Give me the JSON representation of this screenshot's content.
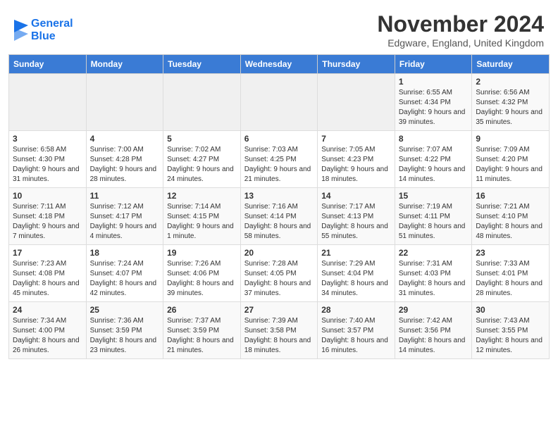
{
  "header": {
    "logo_line1": "General",
    "logo_line2": "Blue",
    "month_title": "November 2024",
    "subtitle": "Edgware, England, United Kingdom"
  },
  "calendar": {
    "days_of_week": [
      "Sunday",
      "Monday",
      "Tuesday",
      "Wednesday",
      "Thursday",
      "Friday",
      "Saturday"
    ],
    "weeks": [
      [
        {
          "day": "",
          "info": ""
        },
        {
          "day": "",
          "info": ""
        },
        {
          "day": "",
          "info": ""
        },
        {
          "day": "",
          "info": ""
        },
        {
          "day": "",
          "info": ""
        },
        {
          "day": "1",
          "info": "Sunrise: 6:55 AM\nSunset: 4:34 PM\nDaylight: 9 hours and 39 minutes."
        },
        {
          "day": "2",
          "info": "Sunrise: 6:56 AM\nSunset: 4:32 PM\nDaylight: 9 hours and 35 minutes."
        }
      ],
      [
        {
          "day": "3",
          "info": "Sunrise: 6:58 AM\nSunset: 4:30 PM\nDaylight: 9 hours and 31 minutes."
        },
        {
          "day": "4",
          "info": "Sunrise: 7:00 AM\nSunset: 4:28 PM\nDaylight: 9 hours and 28 minutes."
        },
        {
          "day": "5",
          "info": "Sunrise: 7:02 AM\nSunset: 4:27 PM\nDaylight: 9 hours and 24 minutes."
        },
        {
          "day": "6",
          "info": "Sunrise: 7:03 AM\nSunset: 4:25 PM\nDaylight: 9 hours and 21 minutes."
        },
        {
          "day": "7",
          "info": "Sunrise: 7:05 AM\nSunset: 4:23 PM\nDaylight: 9 hours and 18 minutes."
        },
        {
          "day": "8",
          "info": "Sunrise: 7:07 AM\nSunset: 4:22 PM\nDaylight: 9 hours and 14 minutes."
        },
        {
          "day": "9",
          "info": "Sunrise: 7:09 AM\nSunset: 4:20 PM\nDaylight: 9 hours and 11 minutes."
        }
      ],
      [
        {
          "day": "10",
          "info": "Sunrise: 7:11 AM\nSunset: 4:18 PM\nDaylight: 9 hours and 7 minutes."
        },
        {
          "day": "11",
          "info": "Sunrise: 7:12 AM\nSunset: 4:17 PM\nDaylight: 9 hours and 4 minutes."
        },
        {
          "day": "12",
          "info": "Sunrise: 7:14 AM\nSunset: 4:15 PM\nDaylight: 9 hours and 1 minute."
        },
        {
          "day": "13",
          "info": "Sunrise: 7:16 AM\nSunset: 4:14 PM\nDaylight: 8 hours and 58 minutes."
        },
        {
          "day": "14",
          "info": "Sunrise: 7:17 AM\nSunset: 4:13 PM\nDaylight: 8 hours and 55 minutes."
        },
        {
          "day": "15",
          "info": "Sunrise: 7:19 AM\nSunset: 4:11 PM\nDaylight: 8 hours and 51 minutes."
        },
        {
          "day": "16",
          "info": "Sunrise: 7:21 AM\nSunset: 4:10 PM\nDaylight: 8 hours and 48 minutes."
        }
      ],
      [
        {
          "day": "17",
          "info": "Sunrise: 7:23 AM\nSunset: 4:08 PM\nDaylight: 8 hours and 45 minutes."
        },
        {
          "day": "18",
          "info": "Sunrise: 7:24 AM\nSunset: 4:07 PM\nDaylight: 8 hours and 42 minutes."
        },
        {
          "day": "19",
          "info": "Sunrise: 7:26 AM\nSunset: 4:06 PM\nDaylight: 8 hours and 39 minutes."
        },
        {
          "day": "20",
          "info": "Sunrise: 7:28 AM\nSunset: 4:05 PM\nDaylight: 8 hours and 37 minutes."
        },
        {
          "day": "21",
          "info": "Sunrise: 7:29 AM\nSunset: 4:04 PM\nDaylight: 8 hours and 34 minutes."
        },
        {
          "day": "22",
          "info": "Sunrise: 7:31 AM\nSunset: 4:03 PM\nDaylight: 8 hours and 31 minutes."
        },
        {
          "day": "23",
          "info": "Sunrise: 7:33 AM\nSunset: 4:01 PM\nDaylight: 8 hours and 28 minutes."
        }
      ],
      [
        {
          "day": "24",
          "info": "Sunrise: 7:34 AM\nSunset: 4:00 PM\nDaylight: 8 hours and 26 minutes."
        },
        {
          "day": "25",
          "info": "Sunrise: 7:36 AM\nSunset: 3:59 PM\nDaylight: 8 hours and 23 minutes."
        },
        {
          "day": "26",
          "info": "Sunrise: 7:37 AM\nSunset: 3:59 PM\nDaylight: 8 hours and 21 minutes."
        },
        {
          "day": "27",
          "info": "Sunrise: 7:39 AM\nSunset: 3:58 PM\nDaylight: 8 hours and 18 minutes."
        },
        {
          "day": "28",
          "info": "Sunrise: 7:40 AM\nSunset: 3:57 PM\nDaylight: 8 hours and 16 minutes."
        },
        {
          "day": "29",
          "info": "Sunrise: 7:42 AM\nSunset: 3:56 PM\nDaylight: 8 hours and 14 minutes."
        },
        {
          "day": "30",
          "info": "Sunrise: 7:43 AM\nSunset: 3:55 PM\nDaylight: 8 hours and 12 minutes."
        }
      ]
    ]
  }
}
